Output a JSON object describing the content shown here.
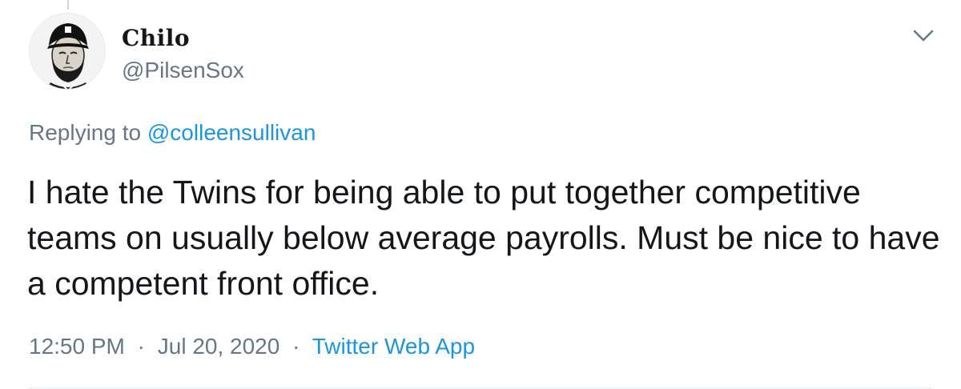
{
  "tweet": {
    "display_name": "Chilo",
    "handle": "@PilsenSox",
    "avatar_icon": "abraham-lincoln-avatar-icon",
    "menu_icon": "chevron-down-icon",
    "replying_prefix": "Replying to",
    "replying_to": "@colleensullivan",
    "text": "I hate the Twins for being able to put together competitive teams on usually below average payrolls. Must be nice to have a competent front office.",
    "time": "12:50 PM",
    "date": "Jul 20, 2020",
    "separator": "·",
    "source": "Twitter Web App"
  },
  "colors": {
    "primary_text": "#14171a",
    "secondary_text": "#657786",
    "link": "#1b95e0",
    "divider": "#e6ecf0"
  }
}
